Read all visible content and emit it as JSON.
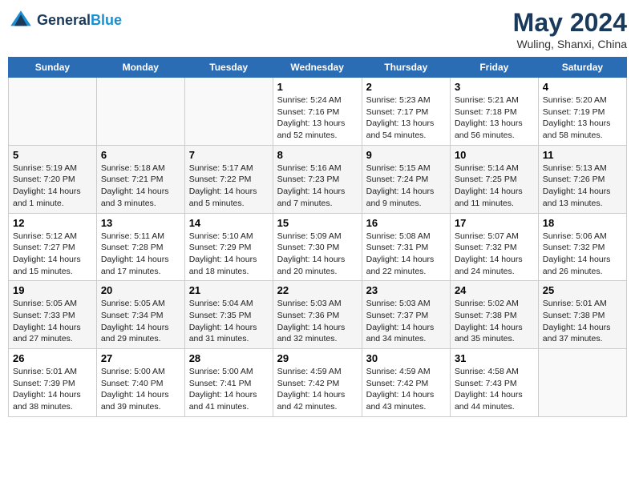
{
  "header": {
    "logo_line1": "General",
    "logo_line2": "Blue",
    "month": "May 2024",
    "location": "Wuling, Shanxi, China"
  },
  "days_of_week": [
    "Sunday",
    "Monday",
    "Tuesday",
    "Wednesday",
    "Thursday",
    "Friday",
    "Saturday"
  ],
  "weeks": [
    [
      {
        "day": "",
        "sunrise": "",
        "sunset": "",
        "daylight": ""
      },
      {
        "day": "",
        "sunrise": "",
        "sunset": "",
        "daylight": ""
      },
      {
        "day": "",
        "sunrise": "",
        "sunset": "",
        "daylight": ""
      },
      {
        "day": "1",
        "sunrise": "Sunrise: 5:24 AM",
        "sunset": "Sunset: 7:16 PM",
        "daylight": "Daylight: 13 hours and 52 minutes."
      },
      {
        "day": "2",
        "sunrise": "Sunrise: 5:23 AM",
        "sunset": "Sunset: 7:17 PM",
        "daylight": "Daylight: 13 hours and 54 minutes."
      },
      {
        "day": "3",
        "sunrise": "Sunrise: 5:21 AM",
        "sunset": "Sunset: 7:18 PM",
        "daylight": "Daylight: 13 hours and 56 minutes."
      },
      {
        "day": "4",
        "sunrise": "Sunrise: 5:20 AM",
        "sunset": "Sunset: 7:19 PM",
        "daylight": "Daylight: 13 hours and 58 minutes."
      }
    ],
    [
      {
        "day": "5",
        "sunrise": "Sunrise: 5:19 AM",
        "sunset": "Sunset: 7:20 PM",
        "daylight": "Daylight: 14 hours and 1 minute."
      },
      {
        "day": "6",
        "sunrise": "Sunrise: 5:18 AM",
        "sunset": "Sunset: 7:21 PM",
        "daylight": "Daylight: 14 hours and 3 minutes."
      },
      {
        "day": "7",
        "sunrise": "Sunrise: 5:17 AM",
        "sunset": "Sunset: 7:22 PM",
        "daylight": "Daylight: 14 hours and 5 minutes."
      },
      {
        "day": "8",
        "sunrise": "Sunrise: 5:16 AM",
        "sunset": "Sunset: 7:23 PM",
        "daylight": "Daylight: 14 hours and 7 minutes."
      },
      {
        "day": "9",
        "sunrise": "Sunrise: 5:15 AM",
        "sunset": "Sunset: 7:24 PM",
        "daylight": "Daylight: 14 hours and 9 minutes."
      },
      {
        "day": "10",
        "sunrise": "Sunrise: 5:14 AM",
        "sunset": "Sunset: 7:25 PM",
        "daylight": "Daylight: 14 hours and 11 minutes."
      },
      {
        "day": "11",
        "sunrise": "Sunrise: 5:13 AM",
        "sunset": "Sunset: 7:26 PM",
        "daylight": "Daylight: 14 hours and 13 minutes."
      }
    ],
    [
      {
        "day": "12",
        "sunrise": "Sunrise: 5:12 AM",
        "sunset": "Sunset: 7:27 PM",
        "daylight": "Daylight: 14 hours and 15 minutes."
      },
      {
        "day": "13",
        "sunrise": "Sunrise: 5:11 AM",
        "sunset": "Sunset: 7:28 PM",
        "daylight": "Daylight: 14 hours and 17 minutes."
      },
      {
        "day": "14",
        "sunrise": "Sunrise: 5:10 AM",
        "sunset": "Sunset: 7:29 PM",
        "daylight": "Daylight: 14 hours and 18 minutes."
      },
      {
        "day": "15",
        "sunrise": "Sunrise: 5:09 AM",
        "sunset": "Sunset: 7:30 PM",
        "daylight": "Daylight: 14 hours and 20 minutes."
      },
      {
        "day": "16",
        "sunrise": "Sunrise: 5:08 AM",
        "sunset": "Sunset: 7:31 PM",
        "daylight": "Daylight: 14 hours and 22 minutes."
      },
      {
        "day": "17",
        "sunrise": "Sunrise: 5:07 AM",
        "sunset": "Sunset: 7:32 PM",
        "daylight": "Daylight: 14 hours and 24 minutes."
      },
      {
        "day": "18",
        "sunrise": "Sunrise: 5:06 AM",
        "sunset": "Sunset: 7:32 PM",
        "daylight": "Daylight: 14 hours and 26 minutes."
      }
    ],
    [
      {
        "day": "19",
        "sunrise": "Sunrise: 5:05 AM",
        "sunset": "Sunset: 7:33 PM",
        "daylight": "Daylight: 14 hours and 27 minutes."
      },
      {
        "day": "20",
        "sunrise": "Sunrise: 5:05 AM",
        "sunset": "Sunset: 7:34 PM",
        "daylight": "Daylight: 14 hours and 29 minutes."
      },
      {
        "day": "21",
        "sunrise": "Sunrise: 5:04 AM",
        "sunset": "Sunset: 7:35 PM",
        "daylight": "Daylight: 14 hours and 31 minutes."
      },
      {
        "day": "22",
        "sunrise": "Sunrise: 5:03 AM",
        "sunset": "Sunset: 7:36 PM",
        "daylight": "Daylight: 14 hours and 32 minutes."
      },
      {
        "day": "23",
        "sunrise": "Sunrise: 5:03 AM",
        "sunset": "Sunset: 7:37 PM",
        "daylight": "Daylight: 14 hours and 34 minutes."
      },
      {
        "day": "24",
        "sunrise": "Sunrise: 5:02 AM",
        "sunset": "Sunset: 7:38 PM",
        "daylight": "Daylight: 14 hours and 35 minutes."
      },
      {
        "day": "25",
        "sunrise": "Sunrise: 5:01 AM",
        "sunset": "Sunset: 7:38 PM",
        "daylight": "Daylight: 14 hours and 37 minutes."
      }
    ],
    [
      {
        "day": "26",
        "sunrise": "Sunrise: 5:01 AM",
        "sunset": "Sunset: 7:39 PM",
        "daylight": "Daylight: 14 hours and 38 minutes."
      },
      {
        "day": "27",
        "sunrise": "Sunrise: 5:00 AM",
        "sunset": "Sunset: 7:40 PM",
        "daylight": "Daylight: 14 hours and 39 minutes."
      },
      {
        "day": "28",
        "sunrise": "Sunrise: 5:00 AM",
        "sunset": "Sunset: 7:41 PM",
        "daylight": "Daylight: 14 hours and 41 minutes."
      },
      {
        "day": "29",
        "sunrise": "Sunrise: 4:59 AM",
        "sunset": "Sunset: 7:42 PM",
        "daylight": "Daylight: 14 hours and 42 minutes."
      },
      {
        "day": "30",
        "sunrise": "Sunrise: 4:59 AM",
        "sunset": "Sunset: 7:42 PM",
        "daylight": "Daylight: 14 hours and 43 minutes."
      },
      {
        "day": "31",
        "sunrise": "Sunrise: 4:58 AM",
        "sunset": "Sunset: 7:43 PM",
        "daylight": "Daylight: 14 hours and 44 minutes."
      },
      {
        "day": "",
        "sunrise": "",
        "sunset": "",
        "daylight": ""
      }
    ]
  ]
}
